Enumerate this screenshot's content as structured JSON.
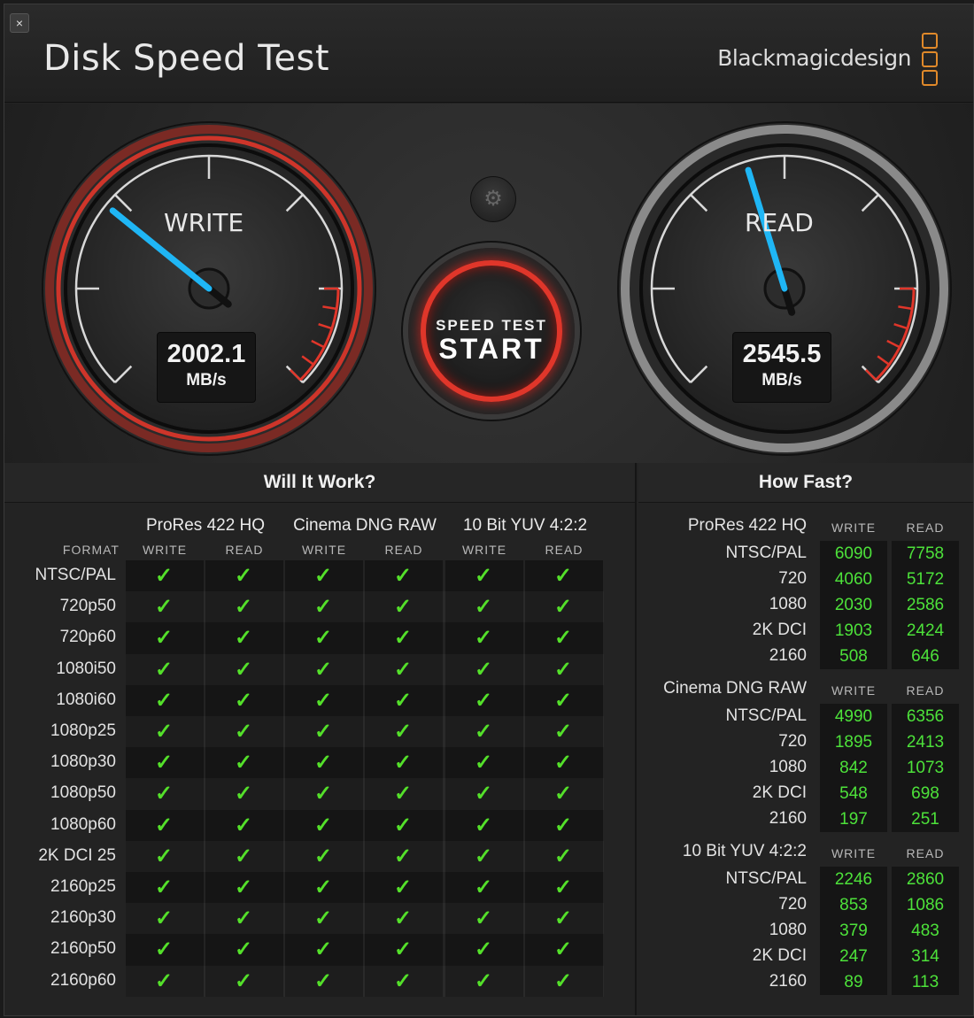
{
  "window": {
    "title": "Disk Speed Test",
    "brand": "Blackmagicdesign",
    "close_icon": "×"
  },
  "gauges": {
    "write": {
      "label": "WRITE",
      "value": "2002.1",
      "unit": "MB/s"
    },
    "read": {
      "label": "READ",
      "value": "2545.5",
      "unit": "MB/s"
    },
    "start": {
      "small": "SPEED TEST",
      "big": "START"
    },
    "settings_icon": "gear-icon",
    "needle_color": "#1fb6f5",
    "redline_color": "#e0362a"
  },
  "will_it_work": {
    "title": "Will It Work?",
    "format_label": "FORMAT",
    "write_label": "WRITE",
    "read_label": "READ",
    "groups": [
      "ProRes 422 HQ",
      "Cinema DNG RAW",
      "10 Bit YUV 4:2:2"
    ],
    "check": "✓",
    "rows": [
      "NTSC/PAL",
      "720p50",
      "720p60",
      "1080i50",
      "1080i60",
      "1080p25",
      "1080p30",
      "1080p50",
      "1080p60",
      "2K DCI 25",
      "2160p25",
      "2160p30",
      "2160p50",
      "2160p60"
    ]
  },
  "how_fast": {
    "title": "How Fast?",
    "write_label": "WRITE",
    "read_label": "READ",
    "sections": [
      {
        "name": "ProRes 422 HQ",
        "rows": [
          {
            "label": "NTSC/PAL",
            "write": "6090",
            "read": "7758"
          },
          {
            "label": "720",
            "write": "4060",
            "read": "5172"
          },
          {
            "label": "1080",
            "write": "2030",
            "read": "2586"
          },
          {
            "label": "2K DCI",
            "write": "1903",
            "read": "2424"
          },
          {
            "label": "2160",
            "write": "508",
            "read": "646"
          }
        ]
      },
      {
        "name": "Cinema DNG RAW",
        "rows": [
          {
            "label": "NTSC/PAL",
            "write": "4990",
            "read": "6356"
          },
          {
            "label": "720",
            "write": "1895",
            "read": "2413"
          },
          {
            "label": "1080",
            "write": "842",
            "read": "1073"
          },
          {
            "label": "2K DCI",
            "write": "548",
            "read": "698"
          },
          {
            "label": "2160",
            "write": "197",
            "read": "251"
          }
        ]
      },
      {
        "name": "10 Bit YUV 4:2:2",
        "rows": [
          {
            "label": "NTSC/PAL",
            "write": "2246",
            "read": "2860"
          },
          {
            "label": "720",
            "write": "853",
            "read": "1086"
          },
          {
            "label": "1080",
            "write": "379",
            "read": "483"
          },
          {
            "label": "2K DCI",
            "write": "247",
            "read": "314"
          },
          {
            "label": "2160",
            "write": "89",
            "read": "113"
          }
        ]
      }
    ]
  }
}
